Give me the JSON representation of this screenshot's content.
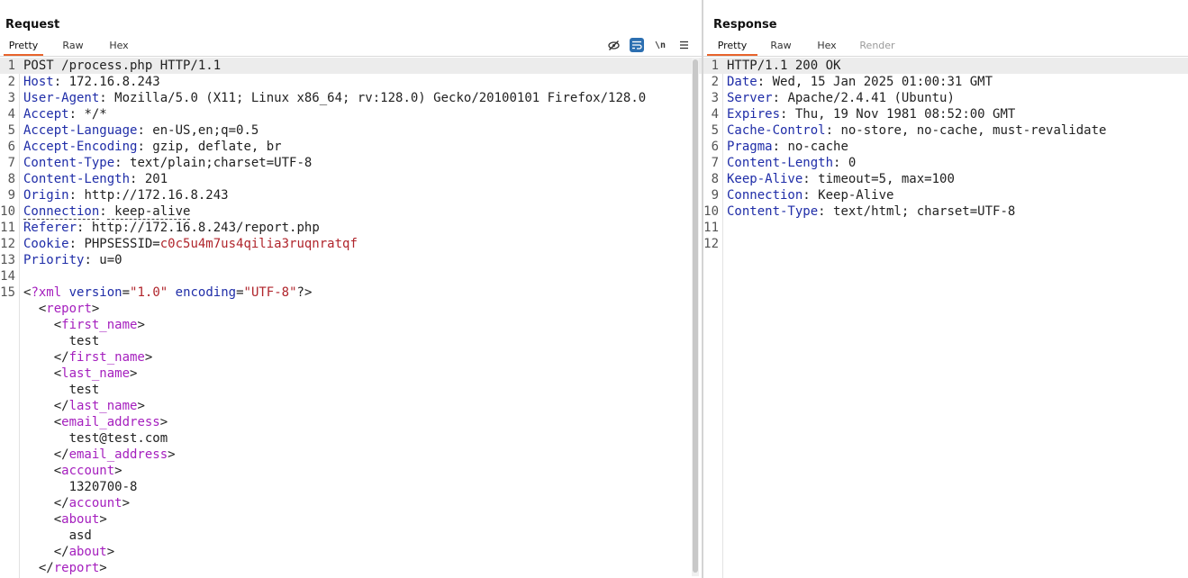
{
  "request": {
    "title": "Request",
    "tabs": [
      "Pretty",
      "Raw",
      "Hex"
    ],
    "toolbar": [
      "eye-slash-icon",
      "wrap-icon",
      "newline-icon",
      "menu-icon"
    ],
    "newline_label": "\\n",
    "lines": [
      {
        "n": "1",
        "k": "",
        "v": "POST /process.php HTTP/1.1"
      },
      {
        "n": "2",
        "k": "Host",
        "v": " 172.16.8.243"
      },
      {
        "n": "3",
        "k": "User-Agent",
        "v": " Mozilla/5.0 (X11; Linux x86_64; rv:128.0) Gecko/20100101 Firefox/128.0"
      },
      {
        "n": "4",
        "k": "Accept",
        "v": " */*"
      },
      {
        "n": "5",
        "k": "Accept-Language",
        "v": " en-US,en;q=0.5"
      },
      {
        "n": "6",
        "k": "Accept-Encoding",
        "v": " gzip, deflate, br"
      },
      {
        "n": "7",
        "k": "Content-Type",
        "v": " text/plain;charset=UTF-8"
      },
      {
        "n": "8",
        "k": "Content-Length",
        "v": " 201"
      },
      {
        "n": "9",
        "k": "Origin",
        "v": " http://172.16.8.243"
      },
      {
        "n": "10",
        "k": "Connection",
        "v": " keep-alive"
      },
      {
        "n": "11",
        "k": "Referer",
        "v": " http://172.16.8.243/report.php"
      },
      {
        "n": "12",
        "k": "Cookie",
        "v": " PHPSESSID=",
        "cv": "c0c5u4m7us4qilia3ruqnratqf"
      },
      {
        "n": "13",
        "k": "Priority",
        "v": " u=0"
      },
      {
        "n": "14",
        "k": "",
        "v": ""
      },
      {
        "n": "15",
        "k": "",
        "v": ""
      }
    ],
    "xml": {
      "decl_open": "<?",
      "decl_name": "xml",
      "attr1": "version",
      "val1": "\"1.0\"",
      "attr2": "encoding",
      "val2": "\"UTF-8\"",
      "decl_close": "?>",
      "root": "report",
      "fields": [
        {
          "tag": "first_name",
          "value": "test"
        },
        {
          "tag": "last_name",
          "value": "test"
        },
        {
          "tag": "email_address",
          "value": "test@test.com"
        },
        {
          "tag": "account",
          "value": "1320700-8"
        },
        {
          "tag": "about",
          "value": "asd"
        }
      ]
    }
  },
  "response": {
    "title": "Response",
    "tabs": [
      "Pretty",
      "Raw",
      "Hex",
      "Render"
    ],
    "lines": [
      {
        "n": "1",
        "k": "",
        "v": "HTTP/1.1 200 OK"
      },
      {
        "n": "2",
        "k": "Date",
        "v": " Wed, 15 Jan 2025 01:00:31 GMT"
      },
      {
        "n": "3",
        "k": "Server",
        "v": " Apache/2.4.41 (Ubuntu)"
      },
      {
        "n": "4",
        "k": "Expires",
        "v": " Thu, 19 Nov 1981 08:52:00 GMT"
      },
      {
        "n": "5",
        "k": "Cache-Control",
        "v": " no-store, no-cache, must-revalidate"
      },
      {
        "n": "6",
        "k": "Pragma",
        "v": " no-cache"
      },
      {
        "n": "7",
        "k": "Content-Length",
        "v": " 0"
      },
      {
        "n": "8",
        "k": "Keep-Alive",
        "v": " timeout=5, max=100"
      },
      {
        "n": "9",
        "k": "Connection",
        "v": " Keep-Alive"
      },
      {
        "n": "10",
        "k": "Content-Type",
        "v": " text/html; charset=UTF-8"
      },
      {
        "n": "11",
        "k": "",
        "v": ""
      },
      {
        "n": "12",
        "k": "",
        "v": ""
      }
    ]
  },
  "colors": {
    "accent": "#e8642c",
    "toggle_on": "#2c6fb1",
    "header_key": "#1f2da8",
    "xml_tag": "#a51fbe",
    "string": "#b0252c"
  }
}
